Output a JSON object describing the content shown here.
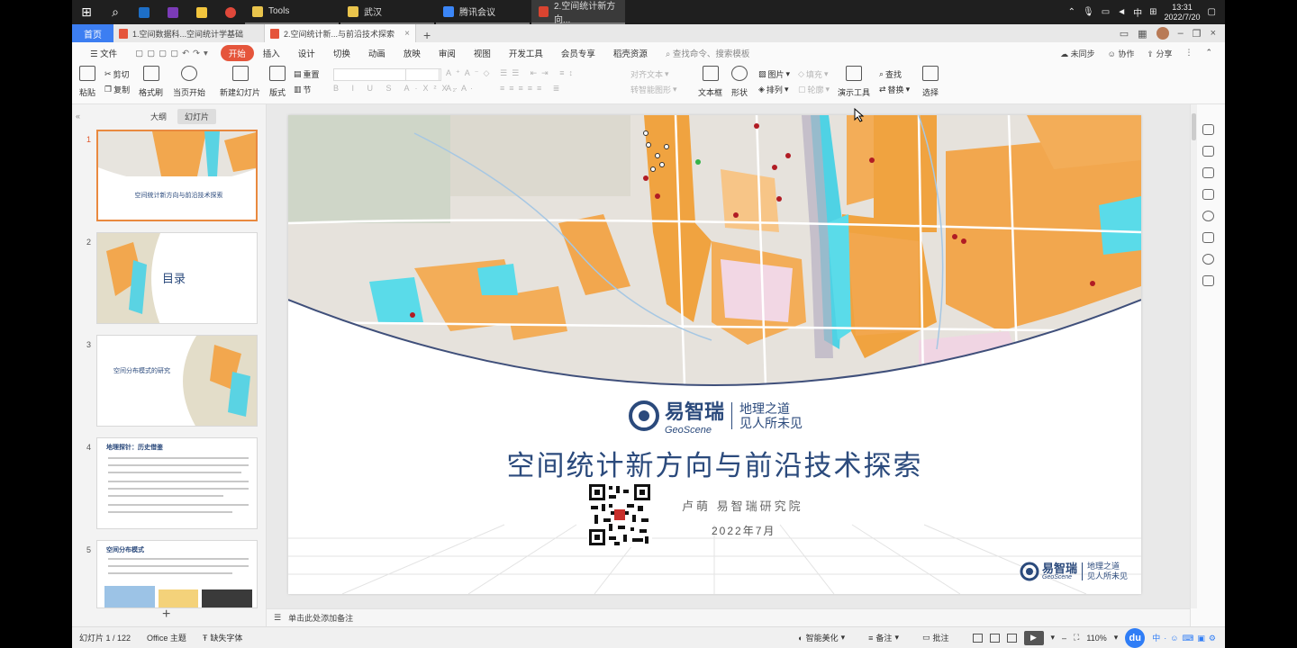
{
  "taskbar": {
    "apps": [
      {
        "label": "Tools",
        "color": "#e9c44c"
      },
      {
        "label": "武汉",
        "color": "#e9c44c"
      },
      {
        "label": "腾讯会议",
        "color": "#3b86f7"
      },
      {
        "label": "2.空间统计新方向...",
        "color": "#d94430"
      }
    ],
    "time": "13:31",
    "date": "2022/7/20",
    "ime": "中"
  },
  "tabs": {
    "home": "首页",
    "docs": [
      {
        "label": "1.空间数据科...空间统计学基础"
      },
      {
        "label": "2.空间统计新...与前沿技术探索"
      }
    ]
  },
  "menu": {
    "file": "文件",
    "items": [
      "开始",
      "插入",
      "设计",
      "切换",
      "动画",
      "放映",
      "审阅",
      "视图",
      "开发工具",
      "会员专享",
      "稻壳资源"
    ],
    "search_placeholder": "查找命令、搜索模板",
    "right": [
      "未同步",
      "协作",
      "分享"
    ]
  },
  "ribbon": {
    "paste": "粘贴",
    "cut": "剪切",
    "copy": "复制",
    "format_painter": "格式刷",
    "from_current": "当页开始",
    "new_slide": "新建幻灯片",
    "layout": "版式",
    "section": "节",
    "reset": "重置",
    "align_text": "对齐文本",
    "convert_smartart": "转智能图形",
    "textbox": "文本框",
    "shape": "形状",
    "picture": "图片",
    "arrange": "排列",
    "fill": "填充",
    "outline": "轮廓",
    "presenter": "演示工具",
    "find": "查找",
    "replace": "替换",
    "select": "选择"
  },
  "left_panel": {
    "outline_tab": "大纲",
    "slides_tab": "幻灯片",
    "thumbnails": [
      {
        "number": "1",
        "title": "空间统计新方向与前沿技术探索"
      },
      {
        "number": "2",
        "title": "目录"
      },
      {
        "number": "3",
        "title": "空间分布模式的研究"
      },
      {
        "number": "4",
        "title": "地理探针：历史借鉴"
      },
      {
        "number": "5",
        "title": "空间分布模式"
      }
    ]
  },
  "slide": {
    "logo_cn": "易智瑞",
    "logo_en": "GeoScene",
    "slogan1": "地理之道",
    "slogan2": "见人所未见",
    "title": "空间统计新方向与前沿技术探索",
    "author": "卢萌  易智瑞研究院",
    "date": "2022年7月"
  },
  "notes": {
    "placeholder": "单击此处添加备注"
  },
  "status": {
    "slide_count": "幻灯片 1 / 122",
    "theme": "Office 主题",
    "missing_fonts": "缺失字体",
    "beautify": "智能美化",
    "notes": "备注",
    "comments": "批注",
    "zoom": "110%"
  }
}
